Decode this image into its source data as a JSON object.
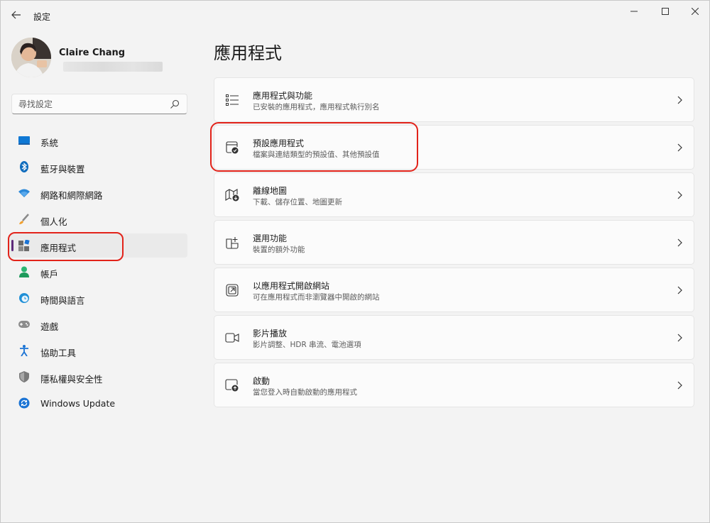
{
  "window": {
    "title": "設定",
    "accent_color": "#5d2b7a",
    "highlight_color": "#e2231a"
  },
  "profile": {
    "name": "Claire Chang"
  },
  "search": {
    "placeholder": "尋找設定"
  },
  "sidebar": {
    "items": [
      {
        "label": "系統",
        "icon": "monitor-icon"
      },
      {
        "label": "藍牙與裝置",
        "icon": "bluetooth-icon"
      },
      {
        "label": "網路和網際網路",
        "icon": "wifi-icon"
      },
      {
        "label": "個人化",
        "icon": "brush-icon"
      },
      {
        "label": "應用程式",
        "icon": "apps-icon",
        "active": true
      },
      {
        "label": "帳戶",
        "icon": "person-icon"
      },
      {
        "label": "時間與語言",
        "icon": "globe-clock-icon"
      },
      {
        "label": "遊戲",
        "icon": "gamepad-icon"
      },
      {
        "label": "協助工具",
        "icon": "accessibility-icon"
      },
      {
        "label": "隱私權與安全性",
        "icon": "shield-icon"
      },
      {
        "label": "Windows Update",
        "icon": "update-icon"
      }
    ]
  },
  "main": {
    "title": "應用程式",
    "cards": [
      {
        "title": "應用程式與功能",
        "subtitle": "已安裝的應用程式，應用程式執行別名",
        "icon": "list-icon"
      },
      {
        "title": "預設應用程式",
        "subtitle": "檔案與連結類型的預設值、其他預設值",
        "icon": "default-app-icon"
      },
      {
        "title": "離線地圖",
        "subtitle": "下載、儲存位置、地圖更新",
        "icon": "map-download-icon"
      },
      {
        "title": "選用功能",
        "subtitle": "裝置的額外功能",
        "icon": "add-grid-icon"
      },
      {
        "title": "以應用程式開啟網站",
        "subtitle": "可在應用程式而非瀏覽器中開啟的網站",
        "icon": "open-external-icon"
      },
      {
        "title": "影片播放",
        "subtitle": "影片調整、HDR 串流、電池選項",
        "icon": "video-camera-icon"
      },
      {
        "title": "啟動",
        "subtitle": "當您登入時自動啟動的應用程式",
        "icon": "startup-icon"
      }
    ]
  }
}
